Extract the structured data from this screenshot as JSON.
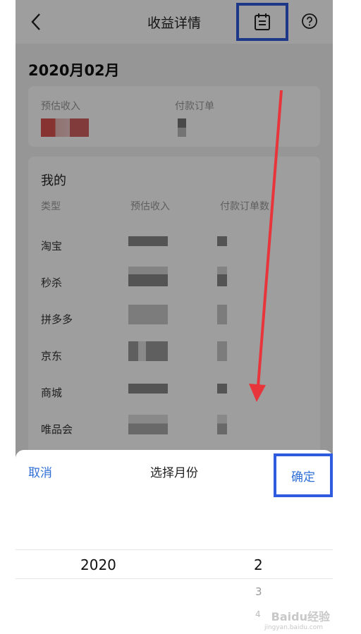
{
  "header": {
    "title": "收益详情",
    "back_icon": "chevron-left-icon",
    "calendar_icon": "calendar-icon",
    "help_icon": "question-circle-icon"
  },
  "month_heading": "2020月02月",
  "summary": {
    "estimated_income_label": "预估收入",
    "paid_orders_label": "付款订单"
  },
  "my_card": {
    "title": "我的",
    "columns": [
      "类型",
      "预估收入",
      "付款订单数"
    ],
    "rows": [
      {
        "type": "淘宝"
      },
      {
        "type": "秒杀"
      },
      {
        "type": "拼多多"
      },
      {
        "type": "京东"
      },
      {
        "type": "商城"
      },
      {
        "type": "唯品会"
      }
    ]
  },
  "sheet": {
    "cancel_label": "取消",
    "title": "选择月份",
    "confirm_label": "确定",
    "selected_year": "2020",
    "selected_month": "2",
    "next_months": [
      "3",
      "4"
    ]
  },
  "watermark": {
    "main": "Baidu经验",
    "sub": "jingyan.baidu.com"
  },
  "colors": {
    "accent": "#2f6fd6",
    "highlight_box": "#2f5bde",
    "annotation_arrow": "#e8353b"
  }
}
